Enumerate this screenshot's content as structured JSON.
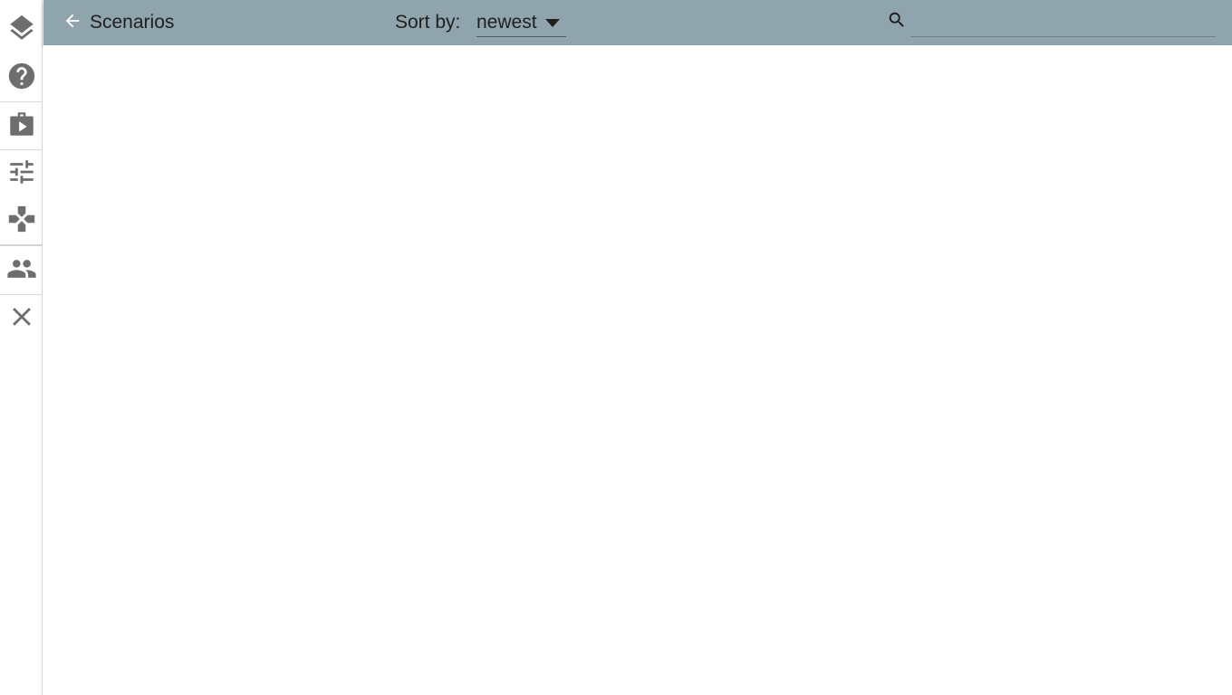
{
  "header": {
    "title": "Scenarios",
    "sort_label": "Sort by:",
    "sort_value": "newest",
    "search_placeholder": ""
  },
  "sidebar": {
    "items": [
      {
        "icon": "layers-icon"
      },
      {
        "icon": "help-icon"
      },
      {
        "icon": "scenario-pack-icon"
      },
      {
        "icon": "tune-icon"
      },
      {
        "icon": "gamepad-icon"
      },
      {
        "icon": "people-icon"
      },
      {
        "icon": "close-icon"
      }
    ]
  },
  "colors": {
    "header_bg": "#90a4ae",
    "icon": "#6e6e6e"
  }
}
